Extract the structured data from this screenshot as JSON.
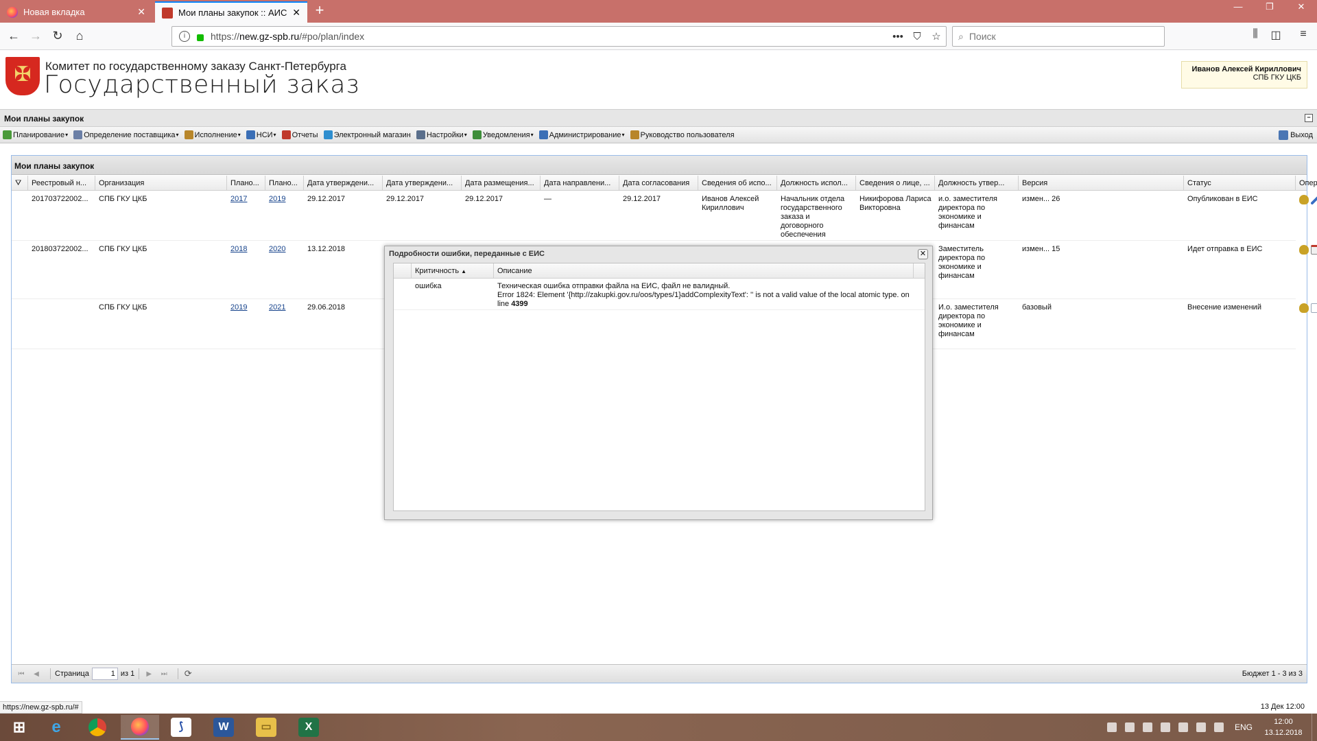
{
  "browser": {
    "tabs": [
      {
        "title": "Новая вкладка",
        "active": false
      },
      {
        "title": "Мои планы закупок :: АИС ГЗ",
        "active": true
      }
    ],
    "url_prefix": "https://",
    "url_host": "new.gz-spb.ru",
    "url_path": "/#po/plan/index",
    "url_dots": "•••",
    "search_placeholder": "Поиск"
  },
  "site": {
    "org_name": "Комитет по государственному заказу Санкт-Петербурга",
    "title": "Государственный заказ",
    "user_name": "Иванов Алексей Кириллович",
    "user_org": "СПБ ГКУ ЦКБ"
  },
  "panel_title": "Мои планы закупок",
  "menu": [
    {
      "label": "Планирование",
      "icon": "planning-icon",
      "color": "#4a9a3a",
      "dropdown": true
    },
    {
      "label": "Определение поставщика",
      "icon": "supplier-icon",
      "color": "#6b7fa6",
      "dropdown": true
    },
    {
      "label": "Исполнение",
      "icon": "execution-icon",
      "color": "#b8862a",
      "dropdown": true
    },
    {
      "label": "НСИ",
      "icon": "reference-icon",
      "color": "#3b6fb6",
      "dropdown": true
    },
    {
      "label": "Отчеты",
      "icon": "reports-icon",
      "color": "#c0392b",
      "dropdown": false
    },
    {
      "label": "Электронный магазин",
      "icon": "shop-icon",
      "color": "#2f8ecf",
      "dropdown": false
    },
    {
      "label": "Настройки",
      "icon": "settings-icon",
      "color": "#5a6f8c",
      "dropdown": true
    },
    {
      "label": "Уведомления",
      "icon": "notifications-icon",
      "color": "#3e8e3a",
      "dropdown": true
    },
    {
      "label": "Администрирование",
      "icon": "admin-icon",
      "color": "#3b6fb6",
      "dropdown": true
    },
    {
      "label": "Руководство пользователя",
      "icon": "manual-icon",
      "color": "#b8862a",
      "dropdown": false
    }
  ],
  "logout_label": "Выход",
  "grid": {
    "title": "Мои планы закупок",
    "columns": [
      "Реестровый н...",
      "Организация",
      "Плано...",
      "Плано...",
      "Дата утверждени...",
      "Дата утверждени...",
      "Дата размещения...",
      "Дата направлени...",
      "Дата согласования",
      "Сведения об испо...",
      "Должность испол...",
      "Сведения о лице, ...",
      "Должность утвер...",
      "Версия",
      "Статус",
      "Операции"
    ],
    "rows": [
      {
        "reg": "201703722002...",
        "org": "СПБ ГКУ ЦКБ",
        "from": "2017",
        "to": "2019",
        "d1": "29.12.2017",
        "d2": "29.12.2017",
        "d3": "29.12.2017",
        "d4": "—",
        "d5": "29.12.2017",
        "exec_name": "Иванов Алексей Кириллович",
        "exec_pos": "Начальник отдела государственного заказа и договорного обеспечения",
        "appr_name": "Никифорова Лариса Викторовна",
        "appr_pos": "и.о. заместителя директора по экономике и финансам",
        "version": "измен... 26",
        "status": "Опубликован в ЕИС",
        "ops": [
          "crest-icon",
          "pencil-icon",
          "stamp-icon",
          "calendar-icon",
          "document-icon",
          "info-icon"
        ]
      },
      {
        "reg": "201803722002...",
        "org": "СПБ ГКУ ЦКБ",
        "from": "2018",
        "to": "2020",
        "d1": "13.12.2018",
        "d2": "",
        "d3": "",
        "d4": "",
        "d5": "",
        "exec_name": "",
        "exec_pos": "",
        "appr_name": "",
        "appr_pos": "Заместитель директора по экономике и финансам",
        "version": "измен... 15",
        "status": "Идет отправка в ЕИС",
        "ops": [
          "crest-icon",
          "calendar-icon",
          "document-icon",
          "info-icon"
        ]
      },
      {
        "reg": "",
        "org": "СПБ ГКУ ЦКБ",
        "from": "2019",
        "to": "2021",
        "d1": "29.06.2018",
        "d2": "",
        "d3": "",
        "d4": "",
        "d5": "",
        "exec_name": "",
        "exec_pos": "",
        "appr_name": "",
        "appr_pos": "И.о. заместителя директора по экономике и финансам",
        "version": "базовый",
        "status": "Внесение изменений",
        "ops": [
          "crest-icon",
          "edit-form-icon",
          "pencil-icon",
          "chart-icon",
          "document-icon",
          "info-icon"
        ]
      }
    ]
  },
  "pager": {
    "page_label": "Страница",
    "page_value": "1",
    "of_label": "из 1",
    "info": "Бюджет 1 - 3 из 3"
  },
  "modal": {
    "title": "Подробности ошибки, переданные с ЕИС",
    "col_severity": "Критичность",
    "col_description": "Описание",
    "rows": [
      {
        "severity": "ошибка",
        "line1": "Техническая ошибка отправки файла на ЕИС, файл не валидный.",
        "line2": "Error 1824: Element '{http://zakupki.gov.ru/oos/types/1}addComplexityText': '' is not a valid value of the local atomic type. on",
        "line3_prefix": "line",
        "line3_bold": "4399"
      }
    ]
  },
  "status_url": "https://new.gz-spb.ru/#",
  "server_time": "13 Дек 12:00",
  "taskbar": {
    "apps": [
      "windows-start",
      "internet-explorer",
      "chrome",
      "firefox",
      "1c",
      "word",
      "explorer",
      "excel"
    ],
    "lang": "ENG",
    "time": "12:00",
    "date": "13.12.2018"
  }
}
